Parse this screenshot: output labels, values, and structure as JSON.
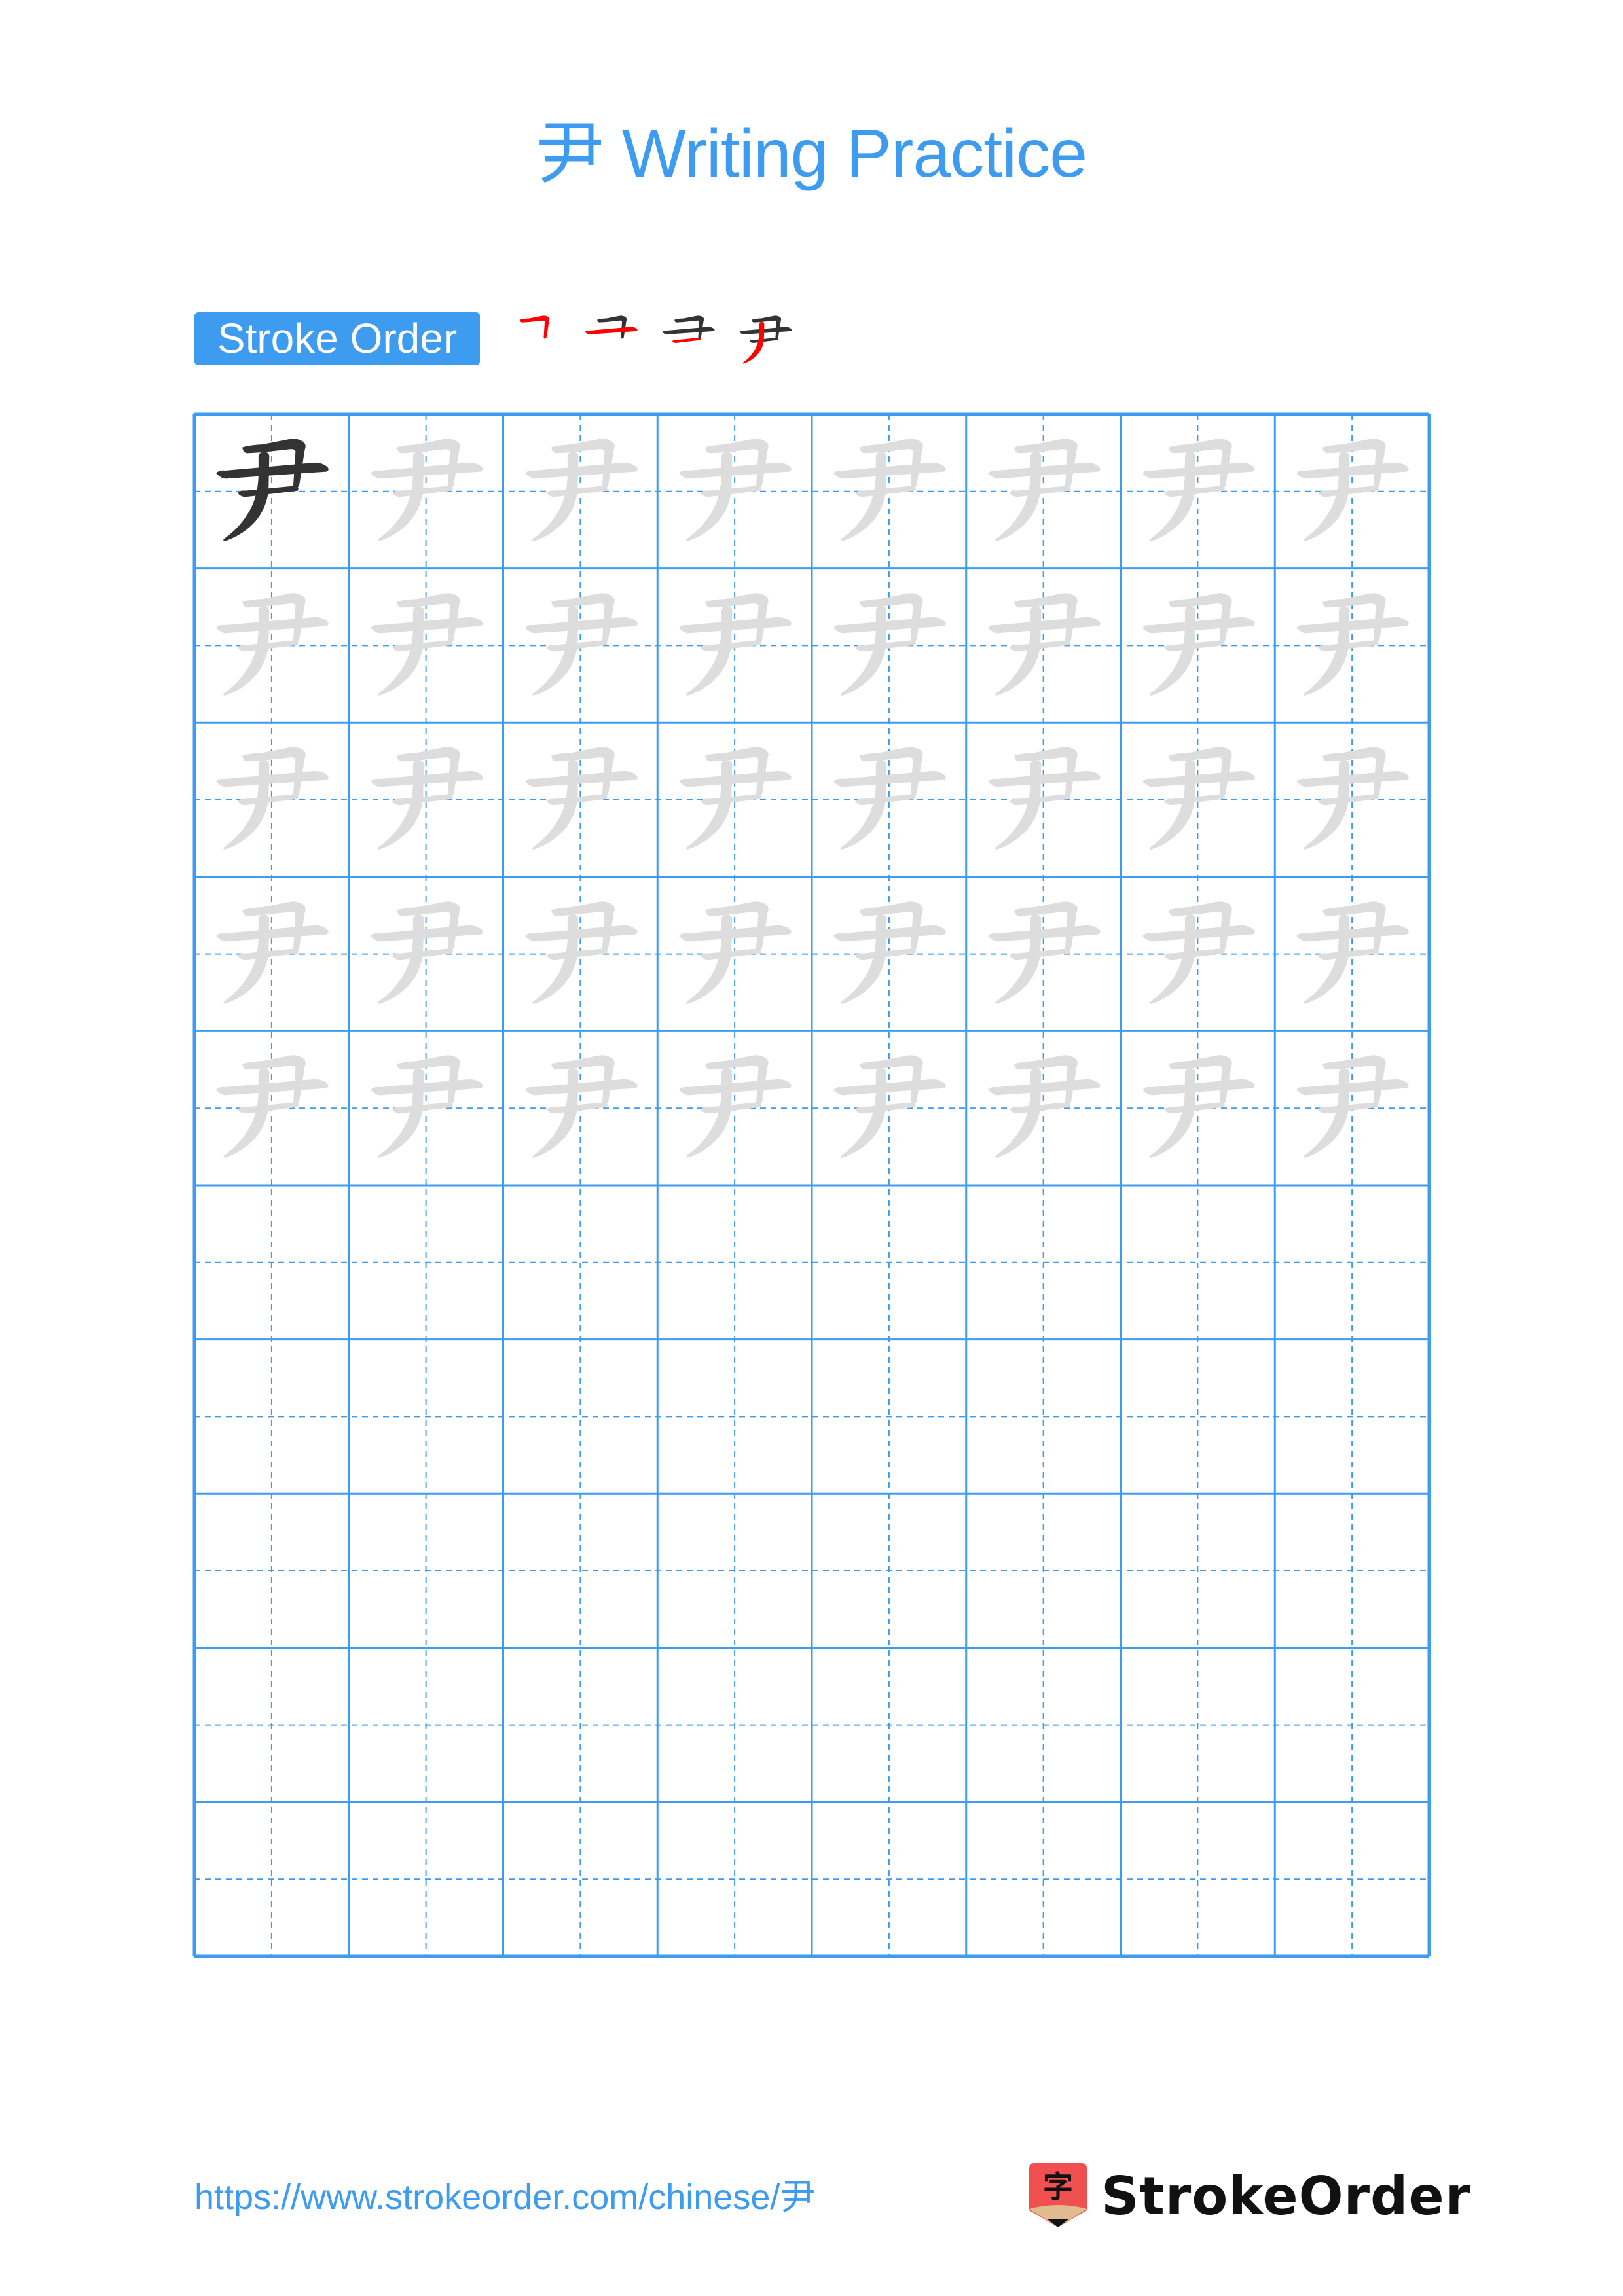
{
  "page": {
    "title": "尹 Writing Practice",
    "character": "尹"
  },
  "stroke_order": {
    "label": "Stroke Order",
    "stroke_count": 4,
    "steps": [
      {
        "step": 1,
        "highlighted_stroke": 1
      },
      {
        "step": 2,
        "highlighted_stroke": 2
      },
      {
        "step": 3,
        "highlighted_stroke": 3
      },
      {
        "step": 4,
        "highlighted_stroke": 4
      }
    ]
  },
  "grid": {
    "columns": 8,
    "rows": 10,
    "model_cells": 1,
    "trace_rows": 5,
    "empty_rows": 5
  },
  "colors": {
    "accent": "#3d9bf0",
    "model_glyph": "#333333",
    "trace_glyph": "#dddddd",
    "highlight_stroke": "#ff0000",
    "logo_red": "#f05050",
    "logo_tan": "#e0bb90"
  },
  "footer": {
    "url": "https://www.strokeorder.com/chinese/尹",
    "brand_name": "StrokeOrder",
    "logo_char": "字"
  }
}
